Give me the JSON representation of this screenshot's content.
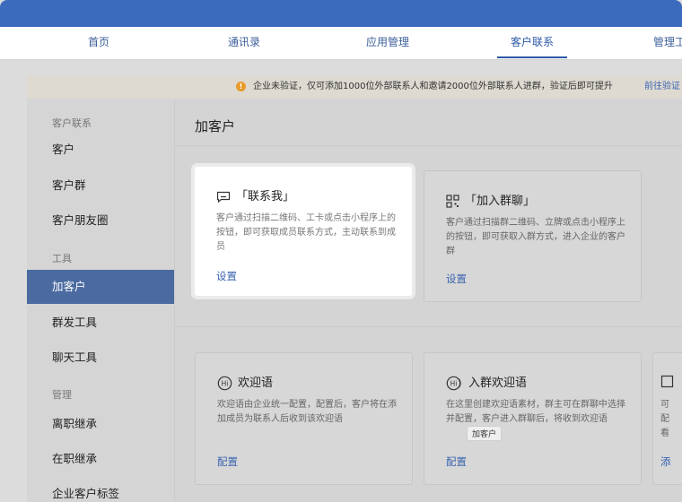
{
  "nav": {
    "tabs": [
      {
        "label": "首页"
      },
      {
        "label": "通讯录"
      },
      {
        "label": "应用管理"
      },
      {
        "label": "客户联系"
      },
      {
        "label": "管理工"
      }
    ]
  },
  "notice": {
    "text": "企业未验证，仅可添加1000位外部联系人和邀请2000位外部联系人进群，验证后即可提升",
    "link": "前往验证"
  },
  "sidebar": {
    "groups": [
      "客户联系",
      "工具",
      "管理"
    ],
    "items": [
      "客户",
      "客户群",
      "客户朋友圈",
      "加客户",
      "群发工具",
      "聊天工具",
      "离职继承",
      "在职继承",
      "企业客户标签"
    ]
  },
  "page": {
    "title": "加客户"
  },
  "cards": [
    {
      "title": "「联系我」",
      "desc": "客户通过扫描二维码、工卡或点击小程序上的按钮，即可获取成员联系方式，主动联系到成员",
      "link": "设置"
    },
    {
      "title": "「加入群聊」",
      "desc": "客户通过扫描群二维码、立牌或点击小程序上的按钮，即可获取入群方式，进入企业的客户群",
      "link": "设置"
    },
    {
      "title": "欢迎语",
      "desc": "欢迎语由企业统一配置，配置后，客户将在添加成员为联系人后收到该欢迎语",
      "link": "配置"
    },
    {
      "title": "入群欢迎语",
      "desc": "在这里创建欢迎语素材，群主可在群聊中选择并配置，客户进入群聊后，将收到欢迎语",
      "link": "配置"
    },
    {
      "desc": "可配看",
      "link": "添"
    }
  ],
  "tooltip": "加客户"
}
